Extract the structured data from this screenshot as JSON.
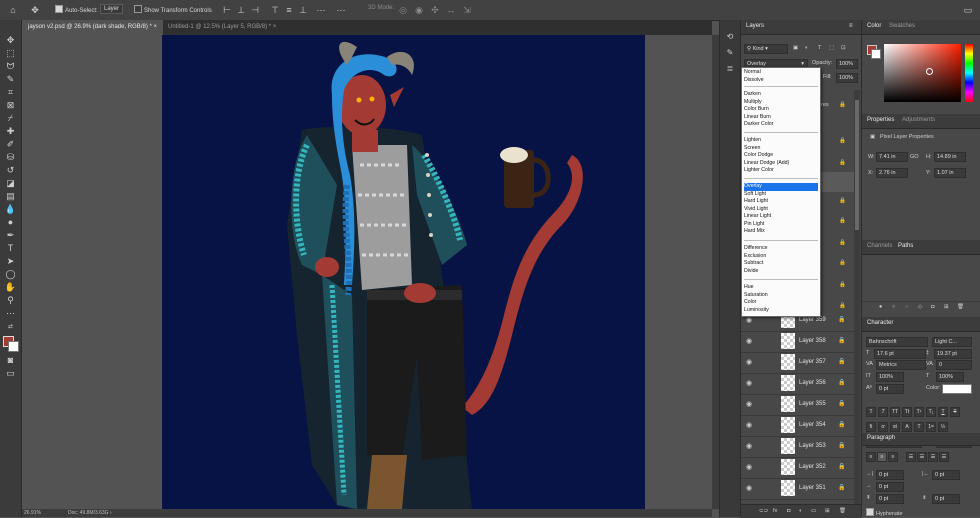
{
  "options_bar": {
    "auto_select_label": "Auto-Select:",
    "auto_select_target": "Layer",
    "show_transform_label": "Show Transform Controls",
    "mode_3d_label": "3D Mode:"
  },
  "document_tabs": [
    {
      "label": "jayson v2.psd @ 26.9% (dark shade, RGB/8) *",
      "active": true
    },
    {
      "label": "Untitled-1 @ 12.5% (Layer 5, RGB/8) *",
      "active": false
    }
  ],
  "status_bar": {
    "zoom": "26.91%",
    "doc_info": "Doc: 49.8M/3.63G"
  },
  "layers_panel": {
    "tab_label": "Layers",
    "filter_kind": "Kind",
    "blend_mode": "Overlay",
    "opacity_label": "Opacity:",
    "opacity_value": "100%",
    "fill_label": "Fill:",
    "fill_value": "100%",
    "partial_label": "res",
    "layers": [
      "Layer 359",
      "Layer 358",
      "Layer 357",
      "Layer 356",
      "Layer 355",
      "Layer 354",
      "Layer 353",
      "Layer 352",
      "Layer 351"
    ]
  },
  "blend_modes": [
    [
      "Normal",
      "Dissolve"
    ],
    [
      "Darken",
      "Multiply",
      "Color Burn",
      "Linear Burn",
      "Darker Color"
    ],
    [
      "Lighten",
      "Screen",
      "Color Dodge",
      "Linear Dodge (Add)",
      "Lighter Color"
    ],
    [
      "Overlay",
      "Soft Light",
      "Hard Light",
      "Vivid Light",
      "Linear Light",
      "Pin Light",
      "Hard Mix"
    ],
    [
      "Difference",
      "Exclusion",
      "Subtract",
      "Divide"
    ],
    [
      "Hue",
      "Saturation",
      "Color",
      "Luminosity"
    ]
  ],
  "highlighted_blend_mode": "Overlay",
  "color_panel": {
    "tab_color": "Color",
    "tab_swatches": "Swatches",
    "foreground": "#a33a34",
    "background": "#ffffff"
  },
  "properties_panel": {
    "tab_properties": "Properties",
    "tab_adjustments": "Adjustments",
    "section_title": "Pixel Layer Properties",
    "w_label": "W:",
    "w_value": "7.41 in",
    "h_label": "H:",
    "h_value": "14.89 in",
    "x_label": "X:",
    "x_value": "2.76 in",
    "y_label": "Y:",
    "y_value": "1.07 in",
    "link_label": "GO"
  },
  "channels_paths": {
    "tab_channels": "Channels",
    "tab_paths": "Paths"
  },
  "character_panel": {
    "tab_label": "Character",
    "font_family": "Bahnschrift",
    "font_style": "Light C...",
    "font_size": "17.6 pt",
    "leading": "19.37 pt",
    "kerning": "Metrics",
    "tracking": "0",
    "vertical_scale": "100%",
    "horizontal_scale": "100%",
    "baseline": "0 pt",
    "color_label": "Color:",
    "language": "English: UK",
    "antialias": "Sharp",
    "glyph_buttons": [
      "T",
      "T",
      "TT",
      "Tt",
      "T¹",
      "T₁",
      "T",
      "T"
    ]
  },
  "paragraph_panel": {
    "tab_label": "Paragraph",
    "indent_left": "0 pt",
    "indent_right": "0 pt",
    "indent_first": "0 pt",
    "space_before": "0 pt",
    "space_after": "0 pt",
    "hyphenate_label": "Hyphenate"
  },
  "colors": {
    "canvas_bg": "#081345",
    "skin": "#a33a34",
    "hair": "#2a8fd8",
    "jacket_pattern": "#35b6bf"
  }
}
